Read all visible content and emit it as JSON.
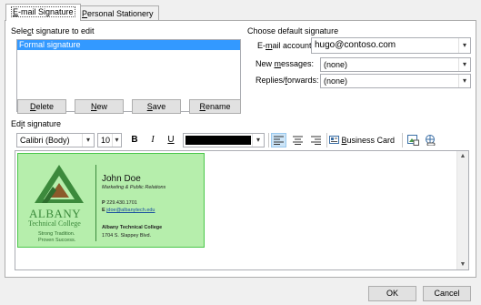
{
  "tabs": [
    {
      "label": "E-mail Signature",
      "accel": "E",
      "rest": "-mail Signature"
    },
    {
      "label": "Personal Stationery",
      "accel": "P",
      "rest": "ersonal Stationery"
    }
  ],
  "select_section": {
    "label_pre": "Sele",
    "label_accel": "c",
    "label_post": "t signature to edit",
    "items": [
      "Formal signature"
    ]
  },
  "buttons": {
    "delete": {
      "accel": "D",
      "rest": "elete"
    },
    "new": {
      "accel": "N",
      "rest": "ew"
    },
    "save": {
      "accel": "S",
      "rest": "ave"
    },
    "rename": {
      "accel": "R",
      "rest": "ename"
    }
  },
  "default_section": {
    "title": "Choose default signature",
    "email_label_pre": "E-",
    "email_label_accel": "m",
    "email_label_post": "ail account:",
    "email_value": "hugo@contoso.com",
    "new_label_pre": "New ",
    "new_label_accel": "m",
    "new_label_post": "essages:",
    "new_value": "(none)",
    "replies_label_pre": "Replies/",
    "replies_label_accel": "f",
    "replies_label_post": "orwards:",
    "replies_value": "(none)"
  },
  "edit_section": {
    "label_pre": "Ed",
    "label_accel": "i",
    "label_post": "t signature",
    "font": "Calibri (Body)",
    "size": "10",
    "bold": "B",
    "italic": "I",
    "underline": "U",
    "font_color": "#000000",
    "business_card_pre": "",
    "business_card_accel": "B",
    "business_card_post": "usiness Card"
  },
  "signature_card": {
    "name": "John Doe",
    "role": "Marketing & Public Relations",
    "phone_label": "P",
    "phone": "229.430.1701",
    "email_label": "E",
    "email": "jdoe@albanytech.edu",
    "college": "Albany Technical College",
    "address": "1704 S. Slappey Blvd.",
    "logo_title": "ALBANY",
    "logo_subtitle": "Technical College",
    "tagline_1": "Strong Tradition.",
    "tagline_2": "Proven Success.",
    "bg_color": "#b6eeac",
    "logo_green": "#3c8a3c",
    "logo_brown": "#8b5a2b"
  },
  "footer": {
    "ok": "OK",
    "cancel": "Cancel"
  }
}
